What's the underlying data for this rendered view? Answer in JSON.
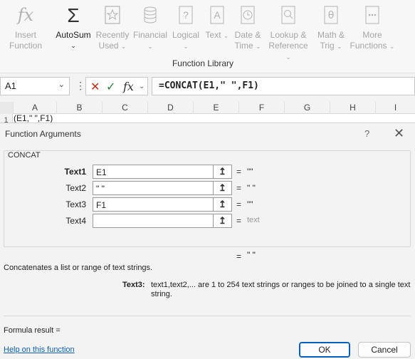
{
  "ribbon": {
    "buttons": [
      {
        "name": "insert-function",
        "line1": "Insert",
        "line2": "Function",
        "chev": ""
      },
      {
        "name": "autosum",
        "line1": "AutoSum",
        "line2": "",
        "chev": "⌄"
      },
      {
        "name": "recently-used",
        "line1": "Recently",
        "line2": "Used",
        "chev": "⌄"
      },
      {
        "name": "financial",
        "line1": "Financial",
        "line2": "",
        "chev": "⌄"
      },
      {
        "name": "logical",
        "line1": "Logical",
        "line2": "",
        "chev": "⌄"
      },
      {
        "name": "text",
        "line1": "Text",
        "line2": "",
        "chev": "⌄"
      },
      {
        "name": "date-time",
        "line1": "Date &",
        "line2": "Time",
        "chev": "⌄"
      },
      {
        "name": "lookup-reference",
        "line1": "Lookup &",
        "line2": "Reference",
        "chev": "⌄"
      },
      {
        "name": "math-trig",
        "line1": "Math &",
        "line2": "Trig",
        "chev": "⌄"
      },
      {
        "name": "more-functions",
        "line1": "More",
        "line2": "Functions",
        "chev": "⌄"
      }
    ],
    "group_label": "Function Library",
    "icons": {
      "insert_function": "fx-icon",
      "autosum": "sigma-icon",
      "recently_used": "star-icon",
      "financial": "coins-icon",
      "logical": "question-book-icon",
      "text": "text-book-icon",
      "date_time": "clock-book-icon",
      "lookup_reference": "magnifier-book-icon",
      "math_trig": "theta-book-icon",
      "more_functions": "more-book-icon"
    }
  },
  "formula_bar": {
    "name_box": "A1",
    "formula": "=CONCAT(E1,\" \",F1)"
  },
  "grid": {
    "columns": [
      "A",
      "B",
      "C",
      "D",
      "E",
      "F",
      "G",
      "H",
      "I"
    ],
    "row1_number": "1",
    "row1_cell": "(E1,\" \",F1)"
  },
  "dialog": {
    "title": "Function Arguments",
    "help": "?",
    "close": "✕",
    "function_name": "CONCAT",
    "args": [
      {
        "label": "Text1",
        "value": "E1",
        "result": "\"\"",
        "bold": true
      },
      {
        "label": "Text2",
        "value": "\" \"",
        "result": "\" \"",
        "bold": false
      },
      {
        "label": "Text3",
        "value": "F1",
        "result": "\"\"",
        "bold": false
      },
      {
        "label": "Text4",
        "value": "",
        "result": "text",
        "bold": false
      }
    ],
    "equals": "=",
    "function_result": "\" \"",
    "description": "Concatenates a list or range of text strings.",
    "arg_name": "Text3:",
    "arg_description": "text1,text2,... are 1 to 254 text strings or ranges to be joined to a single text string.",
    "formula_result_label": "Formula result =",
    "help_link": "Help on this function",
    "ok_label": "OK",
    "cancel_label": "Cancel"
  }
}
